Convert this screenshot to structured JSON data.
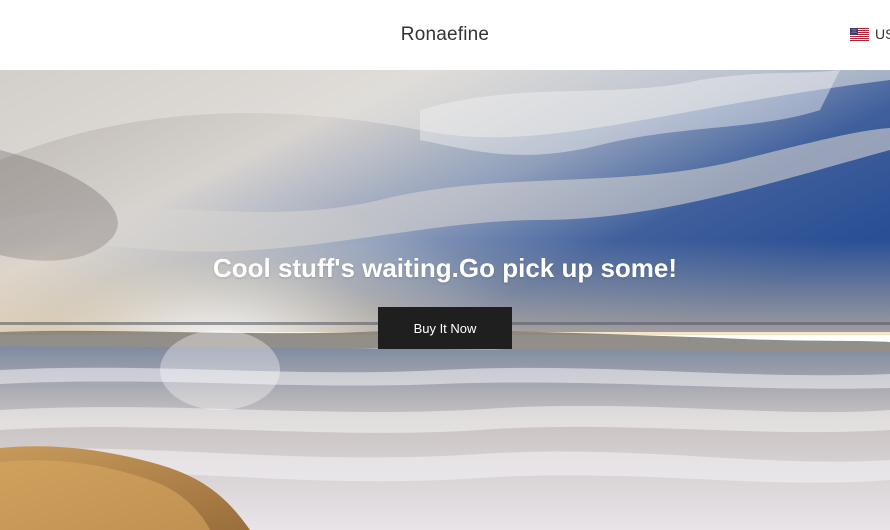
{
  "header": {
    "brand": "Ronaefine",
    "currency": {
      "label": "US",
      "icon": "us-flag-icon"
    }
  },
  "hero": {
    "title": "Cool stuff's waiting.Go pick up some!",
    "button_label": "Buy It Now",
    "background_icon": "beach-sunset-image"
  },
  "colors": {
    "header_bg": "#ffffff",
    "brand_text": "#333333",
    "button_bg": "#1f1f1f",
    "button_text": "#ffffff",
    "hero_text": "#ffffff"
  }
}
